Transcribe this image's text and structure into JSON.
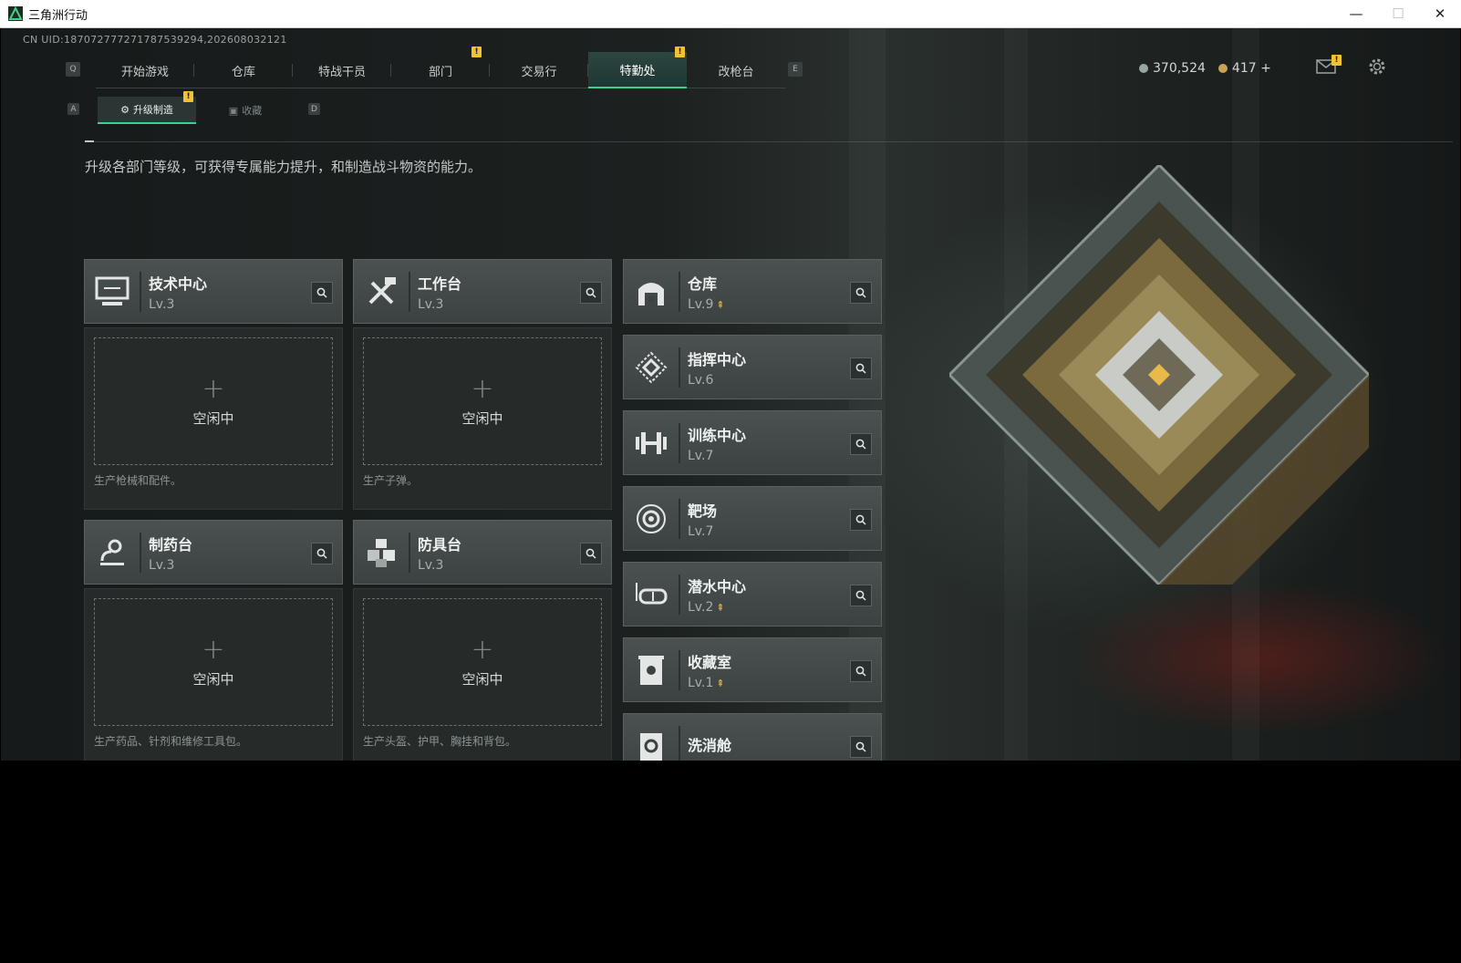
{
  "window": {
    "title": "三角洲行动",
    "controls": {
      "minimize": "—",
      "maximize": "☐",
      "close": "✕"
    }
  },
  "uid": "CN UID:187072777271787539294,202608032121",
  "nav": {
    "key_left": "Q",
    "key_right": "E",
    "tabs": [
      {
        "label": "开始游戏",
        "badge": ""
      },
      {
        "label": "仓库",
        "badge": ""
      },
      {
        "label": "特战干员",
        "badge": ""
      },
      {
        "label": "部门",
        "badge": "!"
      },
      {
        "label": "交易行",
        "badge": ""
      },
      {
        "label": "特勤处",
        "badge": "!",
        "active": true
      },
      {
        "label": "改枪台",
        "badge": ""
      }
    ]
  },
  "currency": {
    "hafbucks": "370,524",
    "coins": "417",
    "add": "+"
  },
  "mail_badge": "!",
  "subnav": {
    "key_left": "A",
    "key_right": "D",
    "tabs": [
      {
        "label": "升级制造",
        "badge": "!",
        "active": true
      },
      {
        "label": "收藏"
      }
    ]
  },
  "description": "升级各部门等级，可获得专属能力提升，和制造战斗物资的能力。",
  "production": [
    {
      "name": "技术中心",
      "level": "Lv.3",
      "icon": "computer-icon",
      "idle": "空闲中",
      "plus": "+",
      "desc": "生产枪械和配件。"
    },
    {
      "name": "工作台",
      "level": "Lv.3",
      "icon": "tools-icon",
      "idle": "空闲中",
      "plus": "+",
      "desc": "生产子弹。"
    },
    {
      "name": "制药台",
      "level": "Lv.3",
      "icon": "microscope-icon",
      "idle": "空闲中",
      "plus": "+",
      "desc": "生产药品、针剂和维修工具包。"
    },
    {
      "name": "防具台",
      "level": "Lv.3",
      "icon": "boxes-icon",
      "idle": "空闲中",
      "plus": "+",
      "desc": "生产头盔、护甲、胸挂和背包。"
    }
  ],
  "facilities": [
    {
      "name": "仓库",
      "level": "Lv.9",
      "upgradable": true,
      "icon": "warehouse-icon"
    },
    {
      "name": "指挥中心",
      "level": "Lv.6",
      "upgradable": false,
      "icon": "command-icon"
    },
    {
      "name": "训练中心",
      "level": "Lv.7",
      "upgradable": false,
      "icon": "dumbbell-icon"
    },
    {
      "name": "靶场",
      "level": "Lv.7",
      "upgradable": false,
      "icon": "target-icon"
    },
    {
      "name": "潜水中心",
      "level": "Lv.2",
      "upgradable": true,
      "icon": "diving-mask-icon"
    },
    {
      "name": "收藏室",
      "level": "Lv.1",
      "upgradable": true,
      "icon": "collection-icon"
    },
    {
      "name": "洗消舱",
      "level": "",
      "upgradable": false,
      "icon": "decon-icon"
    }
  ],
  "colors": {
    "accent": "#37d48e",
    "badge": "#f2c230",
    "upgrade": "#e6b84a"
  }
}
